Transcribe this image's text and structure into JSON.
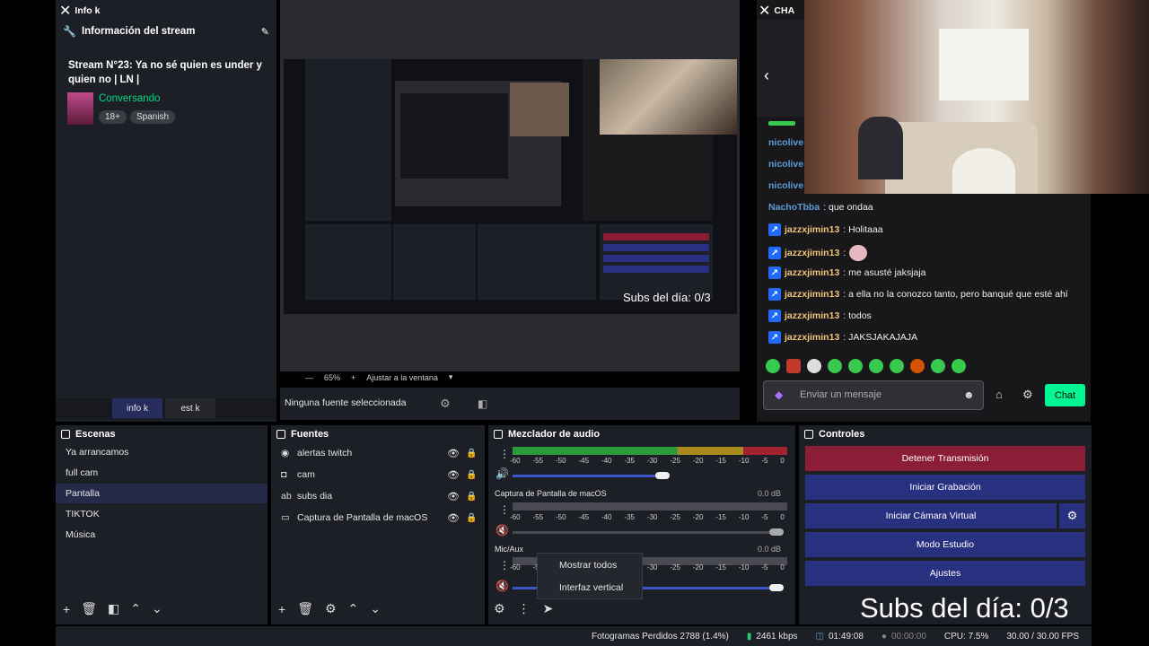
{
  "info_dock": {
    "window_label": "Info k",
    "header": "Información del stream",
    "stream_title": "Stream N°23: Ya no sé quien es under y quien no | LN |",
    "category": "Conversando",
    "tags": [
      "18+",
      "Spanish"
    ],
    "tabs": [
      "info k",
      "est k"
    ]
  },
  "preview": {
    "zoom": "65%",
    "zoom_plus": "+",
    "fit_label": "Ajustar a la ventana",
    "no_source": "Ninguna fuente seleccionada",
    "overlay_subs": "Subs del día: 0/3"
  },
  "chat": {
    "window_label": "CHA",
    "messages": [
      {
        "user": "nicolive",
        "text": ""
      },
      {
        "user": "nicolive",
        "text": ""
      },
      {
        "user": "nicolive",
        "text": ""
      },
      {
        "user": "NachoTbba",
        "text": ": que ondaa"
      },
      {
        "user": "jazzxjimin13",
        "text": ": Holitaaa"
      },
      {
        "user": "jazzxjimin13",
        "text": ":"
      },
      {
        "user": "jazzxjimin13",
        "text": ": me asusté jaksjaja"
      },
      {
        "user": "jazzxjimin13",
        "text": ": a ella no la conozco tanto, pero banqué que esté ahí"
      },
      {
        "user": "jazzxjimin13",
        "text": ": todos"
      },
      {
        "user": "jazzxjimin13",
        "text": ": JAKSJAKAJAJA"
      }
    ],
    "input_placeholder": "Enviar un mensaje",
    "send_label": "Chat"
  },
  "escenas": {
    "title": "Escenas",
    "items": [
      "Ya arrancamos",
      "full cam",
      "Pantalla",
      "TIKTOK",
      "Música"
    ],
    "selected": "Pantalla"
  },
  "fuentes": {
    "title": "Fuentes",
    "items": [
      "alertas twitch",
      "cam",
      "subs dia",
      "Captura de Pantalla de macOS"
    ]
  },
  "mezclador": {
    "title": "Mezclador de audio",
    "channels": [
      {
        "name": "",
        "db": ""
      },
      {
        "name": "Captura de Pantalla de macOS",
        "db": "0.0 dB"
      },
      {
        "name": "Mic/Aux",
        "db": "0.0 dB"
      }
    ],
    "ticks": [
      "-60",
      "-55",
      "-50",
      "-45",
      "-40",
      "-35",
      "-30",
      "-25",
      "-20",
      "-15",
      "-10",
      "-5",
      "0"
    ],
    "context_menu": [
      "Mostrar todos",
      "Interfaz vertical"
    ]
  },
  "controles": {
    "title": "Controles",
    "buttons": [
      "Detener Transmisión",
      "Iniciar Grabación",
      "Iniciar Cámara Virtual",
      "Modo Estudio",
      "Ajustes"
    ]
  },
  "overlay": {
    "subs": "Subs del día: 0/3"
  },
  "statusbar": {
    "dropped": "Fotogramas Perdidos 2788 (1.4%)",
    "bitrate": "2461 kbps",
    "stream_time": "01:49:08",
    "rec_time": "00:00:00",
    "cpu": "CPU: 7.5%",
    "fps": "30.00 / 30.00 FPS"
  },
  "colors": {
    "accent_green": "#00db84",
    "stop_red": "#8b1d36",
    "control_blue": "#283080",
    "selected_scene": "#252a48"
  }
}
